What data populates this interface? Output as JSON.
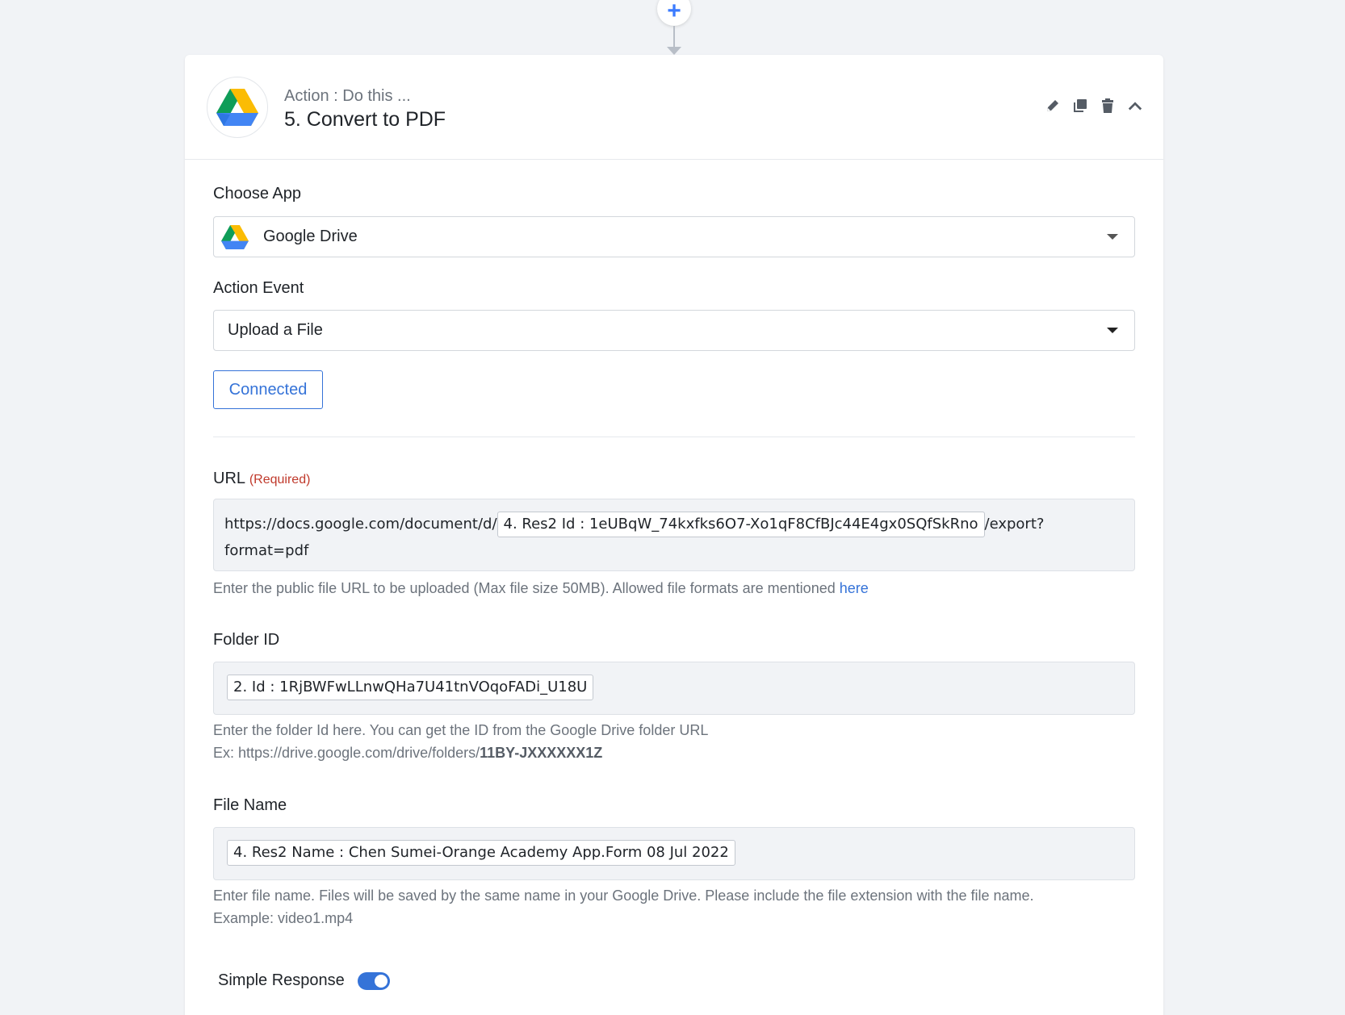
{
  "connector": {
    "add_symbol": "+"
  },
  "step": {
    "subtitle": "Action : Do this ...",
    "title": "5. Convert to PDF",
    "app_icon": "google-drive-icon",
    "actions": [
      "edit-icon",
      "copy-icon",
      "delete-icon",
      "collapse-icon"
    ]
  },
  "choose_app": {
    "label": "Choose App",
    "value": "Google Drive"
  },
  "action_event": {
    "label": "Action Event",
    "value": "Upload a File"
  },
  "connection": {
    "button_label": "Connected"
  },
  "url_field": {
    "label": "URL",
    "required": "(Required)",
    "prefix": "https://docs.google.com/document/d/",
    "token": "4. Res2 Id : 1eUBqW_74kxfks6O7-Xo1qF8CfBJc44E4gx0SQfSkRno",
    "suffix": "/export?",
    "line2": "format=pdf",
    "help": "Enter the public file URL to be uploaded (Max file size 50MB). Allowed file formats are mentioned",
    "help_link": "here"
  },
  "folder_field": {
    "label": "Folder ID",
    "token": "2. Id : 1RjBWFwLLnwQHa7U41tnVOqoFADi_U18U",
    "help_line1": "Enter the folder Id here. You can get the ID from the Google Drive folder URL",
    "help_line2_prefix": "Ex: https://drive.google.com/drive/folders/",
    "help_line2_bold": "11BY-JXXXXXX1Z"
  },
  "file_name_field": {
    "label": "File Name",
    "token": "4. Res2 Name : Chen Sumei-Orange Academy App.Form 08 Jul 2022",
    "help_line1": "Enter file name. Files will be saved by the same name in your Google Drive. Please include the file extension with the file name.",
    "help_line2": "Example: video1.mp4"
  },
  "simple_response": {
    "label": "Simple Response",
    "enabled": true
  },
  "colors": {
    "accent": "#3573d8",
    "required": "#c0392b",
    "background": "#f1f3f6"
  }
}
